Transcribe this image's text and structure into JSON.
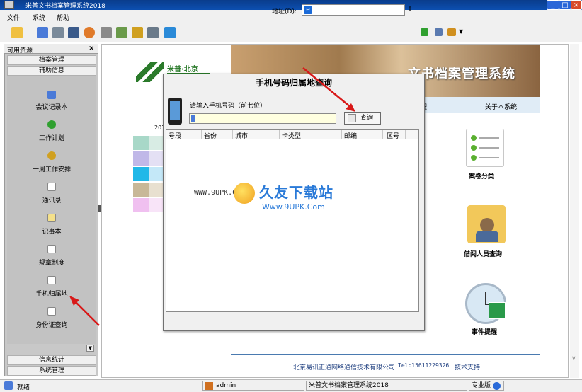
{
  "window": {
    "title": "米普文书档案管理系统2018"
  },
  "menu": [
    "文件",
    "系统",
    "帮助"
  ],
  "toolbar": {
    "address_label": "地址(D):",
    "address_value": ""
  },
  "left_panel": {
    "title": "可用资源",
    "close": "×",
    "top_sections": [
      "档案管理",
      "辅助信息"
    ],
    "items": [
      {
        "label": "会议记录本",
        "icon": "table-icon"
      },
      {
        "label": "工作计划",
        "icon": "go-icon"
      },
      {
        "label": "一周工作安排",
        "icon": "pin-icon"
      },
      {
        "label": "通讯录",
        "icon": "doc-icon"
      },
      {
        "label": "记事本",
        "icon": "note-icon"
      },
      {
        "label": "规章制度",
        "icon": "rules-icon"
      },
      {
        "label": "手机归属地",
        "icon": "phone-icon"
      },
      {
        "label": "身份证查询",
        "icon": "id-icon"
      }
    ],
    "bottom_sections": [
      "信息统计",
      "系统管理"
    ]
  },
  "main": {
    "logo_text": "米普·北京",
    "banner_title": "文书档案管理系统",
    "nav_partial": "理",
    "nav_about": "关于本系统",
    "calendar_year": "201",
    "categories": [
      "案卷分类",
      "借阅人员查询",
      "事件提醒"
    ],
    "footer_company": "北京易讯正通网络通信技术有限公司",
    "footer_tel": "Tel:15611229326",
    "footer_support": "技术支持"
  },
  "dialog": {
    "title": "手机号码归属地查询",
    "prompt": "请输入手机号码（前七位）",
    "input_value": "",
    "button": "查询",
    "columns": [
      "号段",
      "省份",
      "城市",
      "卡类型",
      "邮编",
      "区号"
    ]
  },
  "watermark": {
    "url": "WWW.9UPK.COM",
    "text": "久友下载站",
    "sub": "Www.9UPK.Com"
  },
  "statusbar": {
    "ready": "就绪",
    "user": "admin",
    "app": "米普文书档案管理系统2018",
    "edition": "专业版"
  },
  "colors": {
    "titlebar": "#0c4fb0",
    "arrow": "#d81818",
    "accent": "#2a7ad8"
  }
}
